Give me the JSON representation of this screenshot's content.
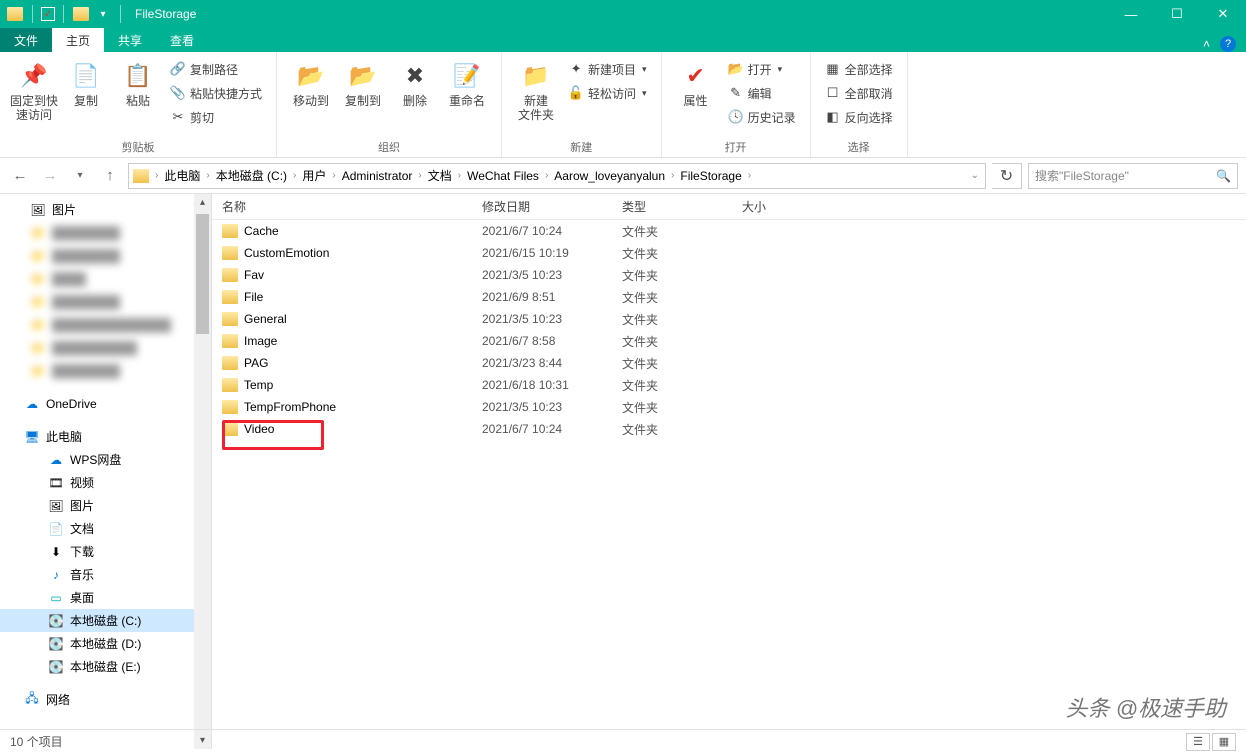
{
  "title": "FileStorage",
  "tabs": {
    "file": "文件",
    "home": "主页",
    "share": "共享",
    "view": "查看"
  },
  "ribbon": {
    "clipboard": {
      "pin": "固定到快\n速访问",
      "copy": "复制",
      "paste": "粘贴",
      "copypath": "复制路径",
      "pasteshortcut": "粘贴快捷方式",
      "cut": "剪切",
      "label": "剪贴板"
    },
    "organize": {
      "moveto": "移动到",
      "copyto": "复制到",
      "delete": "删除",
      "rename": "重命名",
      "label": "组织"
    },
    "new": {
      "newfolder": "新建\n文件夹",
      "newitem": "新建项目",
      "easyaccess": "轻松访问",
      "label": "新建"
    },
    "open": {
      "properties": "属性",
      "open": "打开",
      "edit": "编辑",
      "history": "历史记录",
      "label": "打开"
    },
    "select": {
      "selectall": "全部选择",
      "selectnone": "全部取消",
      "invert": "反向选择",
      "label": "选择"
    }
  },
  "breadcrumbs": [
    "此电脑",
    "本地磁盘 (C:)",
    "用户",
    "Administrator",
    "文档",
    "WeChat Files",
    "Aarow_loveyanyalun",
    "FileStorage"
  ],
  "search_placeholder": "搜索\"FileStorage\"",
  "columns": {
    "name": "名称",
    "date": "修改日期",
    "type": "类型",
    "size": "大小"
  },
  "tree": {
    "pictures": "图片",
    "onedrive": "OneDrive",
    "thispc": "此电脑",
    "wps": "WPS网盘",
    "videos": "视频",
    "pics2": "图片",
    "docs": "文档",
    "downloads": "下载",
    "music": "音乐",
    "desktop": "桌面",
    "diskc": "本地磁盘 (C:)",
    "diskd": "本地磁盘 (D:)",
    "diske": "本地磁盘 (E:)",
    "network": "网络"
  },
  "files": [
    {
      "name": "Cache",
      "date": "2021/6/7 10:24",
      "type": "文件夹"
    },
    {
      "name": "CustomEmotion",
      "date": "2021/6/15 10:19",
      "type": "文件夹"
    },
    {
      "name": "Fav",
      "date": "2021/3/5 10:23",
      "type": "文件夹"
    },
    {
      "name": "File",
      "date": "2021/6/9 8:51",
      "type": "文件夹"
    },
    {
      "name": "General",
      "date": "2021/3/5 10:23",
      "type": "文件夹"
    },
    {
      "name": "Image",
      "date": "2021/6/7 8:58",
      "type": "文件夹"
    },
    {
      "name": "PAG",
      "date": "2021/3/23 8:44",
      "type": "文件夹"
    },
    {
      "name": "Temp",
      "date": "2021/6/18 10:31",
      "type": "文件夹"
    },
    {
      "name": "TempFromPhone",
      "date": "2021/3/5 10:23",
      "type": "文件夹"
    },
    {
      "name": "Video",
      "date": "2021/6/7 10:24",
      "type": "文件夹",
      "highlight": true
    }
  ],
  "status": "10 个项目",
  "watermark": "头条 @极速手助"
}
